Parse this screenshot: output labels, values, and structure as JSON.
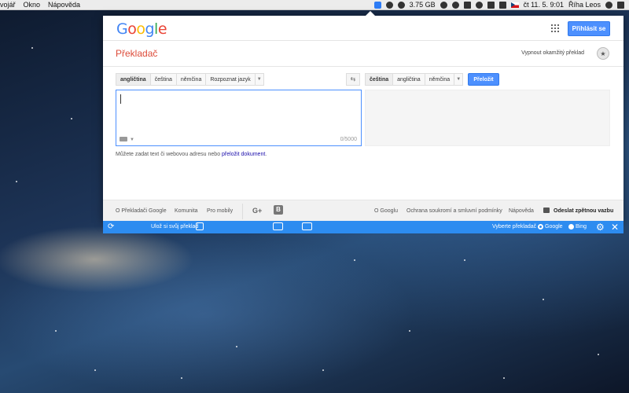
{
  "menubar": {
    "menus": [
      "vojář",
      "Okno",
      "Nápověda"
    ],
    "memory": "3.75 GB",
    "clock": "čt 11. 5.  9:01",
    "user": "Říha Leos"
  },
  "header": {
    "logo_letters": [
      "G",
      "o",
      "o",
      "g",
      "l",
      "e"
    ],
    "signin_label": "Přihlásit se"
  },
  "subbar": {
    "title": "Překladač",
    "instant_off": "Vypnout okamžitý překlad"
  },
  "source_langs": [
    "angličtina",
    "čeština",
    "němčina",
    "Rozpoznat jazyk"
  ],
  "target_langs": [
    "čeština",
    "angličtina",
    "němčina"
  ],
  "translate_label": "Přeložit",
  "source": {
    "value": "",
    "char_count": "0/5000"
  },
  "hint": {
    "text": "Můžete zadat text či webovou adresu nebo ",
    "link": "přeložit dokument",
    "end": "."
  },
  "footer": {
    "left_links": [
      "O Překladači Google",
      "Komunita",
      "Pro mobily"
    ],
    "gplus": "G+",
    "blogger": "B",
    "right_links": [
      "O Googlu",
      "Ochrana soukromí a smluvní podmínky",
      "Nápověda"
    ],
    "feedback": "Odeslat zpětnou vazbu"
  },
  "toolbar": {
    "save_label": "Ulož si svůj překlad",
    "choose_label": "Vyberte překladač",
    "option_google": "Google",
    "option_bing": "Bing",
    "selected": "Google",
    "accent": "#2d8cf0"
  }
}
